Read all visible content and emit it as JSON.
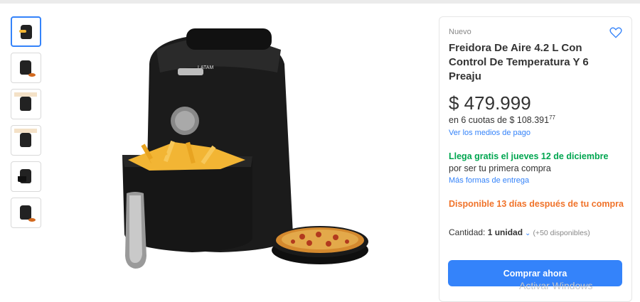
{
  "gallery": {
    "thumbnails": [
      "airfryer-front",
      "airfryer-with-pizza",
      "airfryer-features",
      "airfryer-lifestyle",
      "airfryer-set",
      "airfryer-accessories"
    ],
    "main_image": "airfryer-with-fries-and-pizza",
    "brand_mark": "LATAM"
  },
  "product": {
    "condition": "Nuevo",
    "title": "Freidora De Aire 4.2 L Con Control De Temperatura Y 6 Preaju",
    "price": "$ 479.999",
    "installments_prefix": "en 6 cuotas de $ 108.391",
    "installments_cents": "77",
    "payment_link": "Ver los medios de pago",
    "delivery_highlight": "Llega gratis el jueves 12 de diciembre",
    "delivery_rest": " por ser tu primera compra",
    "delivery_link": "Más formas de entrega",
    "availability": "Disponible 13 días después de tu compra",
    "quantity_label": "Cantidad: ",
    "quantity_value": "1 unidad",
    "quantity_available": "(+50 disponibles)",
    "buy_button": "Comprar ahora"
  },
  "icons": {
    "favorite": "heart-icon",
    "dropdown": "chevron-down-icon"
  },
  "colors": {
    "accent": "#3483fa",
    "success": "#00a650",
    "warning": "#f0732a"
  },
  "watermark": "Activar Windows"
}
